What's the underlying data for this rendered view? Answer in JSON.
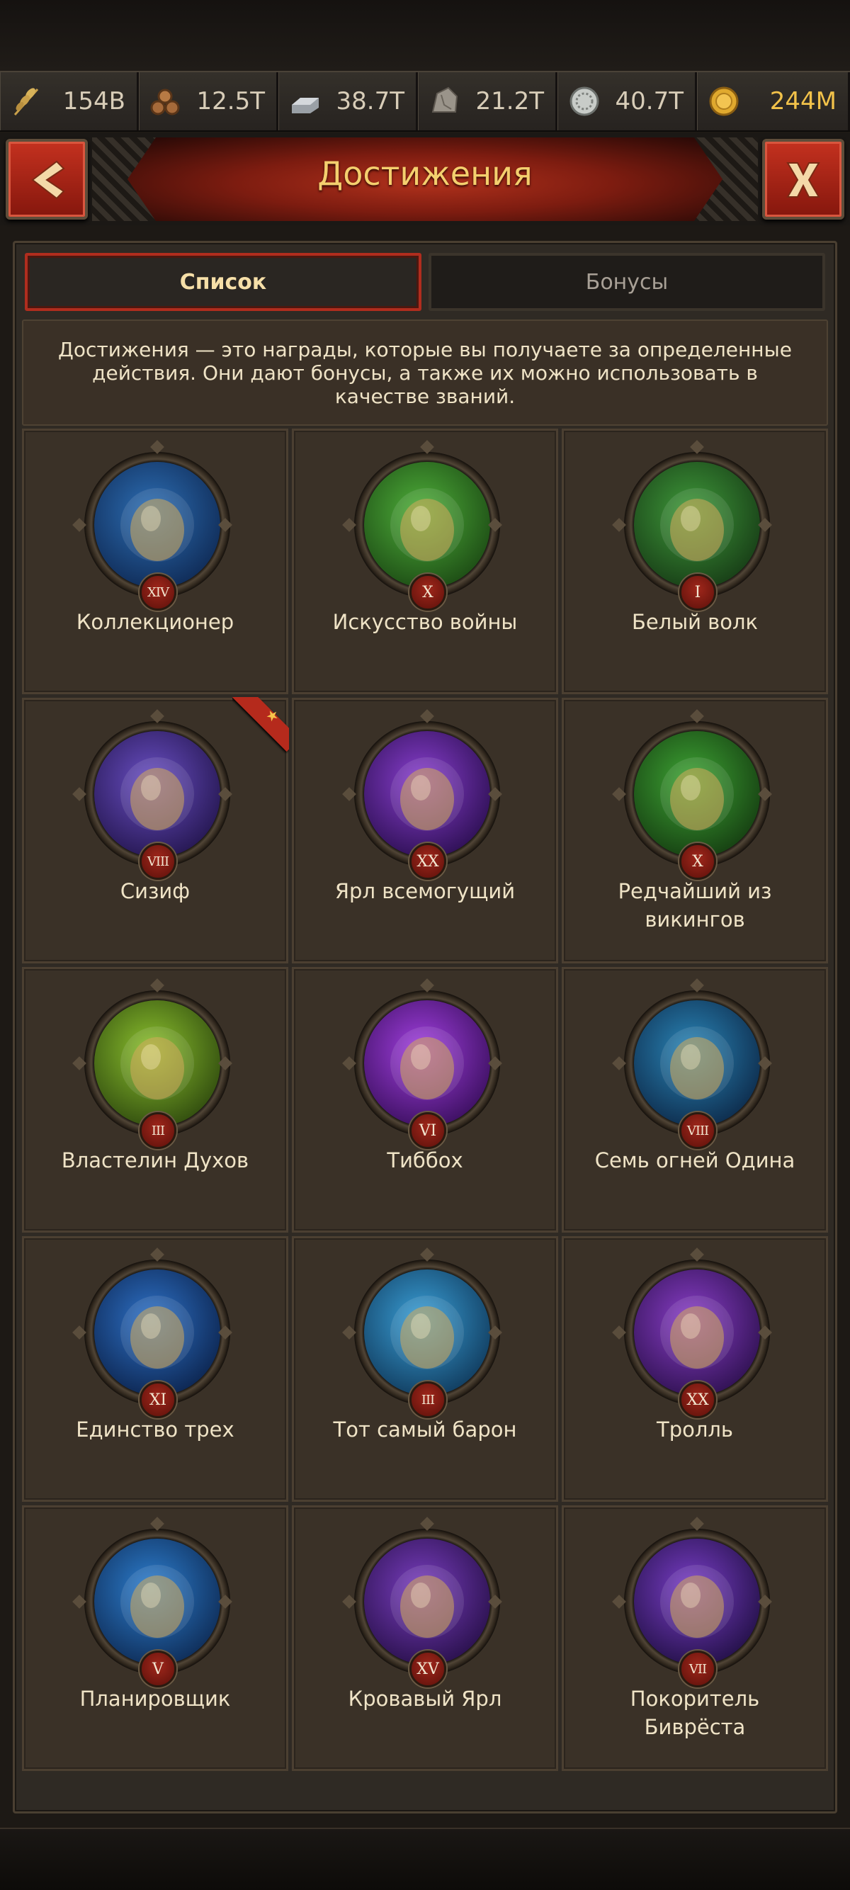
{
  "resources": [
    {
      "icon": "wheat-icon",
      "value": "154B"
    },
    {
      "icon": "wood-logs-icon",
      "value": "12.5T"
    },
    {
      "icon": "iron-ingot-icon",
      "value": "38.7T"
    },
    {
      "icon": "stone-icon",
      "value": "21.2T"
    },
    {
      "icon": "silver-coin-icon",
      "value": "40.7T"
    },
    {
      "icon": "gold-coin-icon",
      "value": "244M"
    }
  ],
  "header": {
    "title": "Достижения"
  },
  "tabs": {
    "list": "Список",
    "bonuses": "Бонусы"
  },
  "description": "Достижения — это награды, которые вы получаете за определенные действия. Они дают бонусы, а также их можно использовать в качестве званий.",
  "achievements": [
    {
      "name": "Коллекционер",
      "rank": "XIV",
      "icon": "fist-coins-icon",
      "colors": [
        "#2d6fb5",
        "#0f2a55"
      ]
    },
    {
      "name": "Искусство войны",
      "rank": "X",
      "icon": "two-masks-icon",
      "colors": [
        "#4fb03a",
        "#1c4a14"
      ]
    },
    {
      "name": "Белый волк",
      "rank": "I",
      "icon": "wolf-head-icon",
      "colors": [
        "#3f9a3a",
        "#173c16"
      ]
    },
    {
      "name": "Сизиф",
      "rank": "VIII",
      "icon": "boulder-hammer-icon",
      "colors": [
        "#6a4fc4",
        "#24164f"
      ],
      "ribbon": true
    },
    {
      "name": "Ярл всемогущий",
      "rank": "XX",
      "icon": "flaming-sword-icon",
      "colors": [
        "#8a3fd0",
        "#2c0f52"
      ]
    },
    {
      "name": "Редчайший из викингов",
      "rank": "X",
      "icon": "golden-warrior-icon",
      "colors": [
        "#3ea534",
        "#153d11"
      ]
    },
    {
      "name": "Властелин Духов",
      "rank": "III",
      "icon": "spirit-orbs-icon",
      "colors": [
        "#8cc12e",
        "#2f4a0e"
      ]
    },
    {
      "name": "Тиббох",
      "rank": "VI",
      "icon": "purple-eye-icon",
      "colors": [
        "#a23fe0",
        "#3a0f5e"
      ]
    },
    {
      "name": "Семь огней Одина",
      "rank": "VIII",
      "icon": "meteors-icon",
      "colors": [
        "#2a86b8",
        "#0d2a4a"
      ]
    },
    {
      "name": "Единство трех",
      "rank": "XI",
      "icon": "globe-icon",
      "colors": [
        "#2e72c8",
        "#0c244e"
      ]
    },
    {
      "name": "Тот самый барон",
      "rank": "III",
      "icon": "baron-hat-icon",
      "colors": [
        "#3aa0d8",
        "#103a5c"
      ]
    },
    {
      "name": "Тролль",
      "rank": "XX",
      "icon": "troll-icon",
      "colors": [
        "#8a3ec8",
        "#2e1150"
      ]
    },
    {
      "name": "Планировщик",
      "rank": "V",
      "icon": "blueprint-compass-icon",
      "colors": [
        "#2d7fd0",
        "#0e2b55"
      ]
    },
    {
      "name": "Кровавый Ярл",
      "rank": "XV",
      "icon": "axe-stump-icon",
      "colors": [
        "#7a3ec0",
        "#28104a"
      ]
    },
    {
      "name": "Покоритель Биврёста",
      "rank": "VII",
      "icon": "rainbow-bridge-icon",
      "colors": [
        "#7a3ec8",
        "#221046"
      ]
    }
  ]
}
